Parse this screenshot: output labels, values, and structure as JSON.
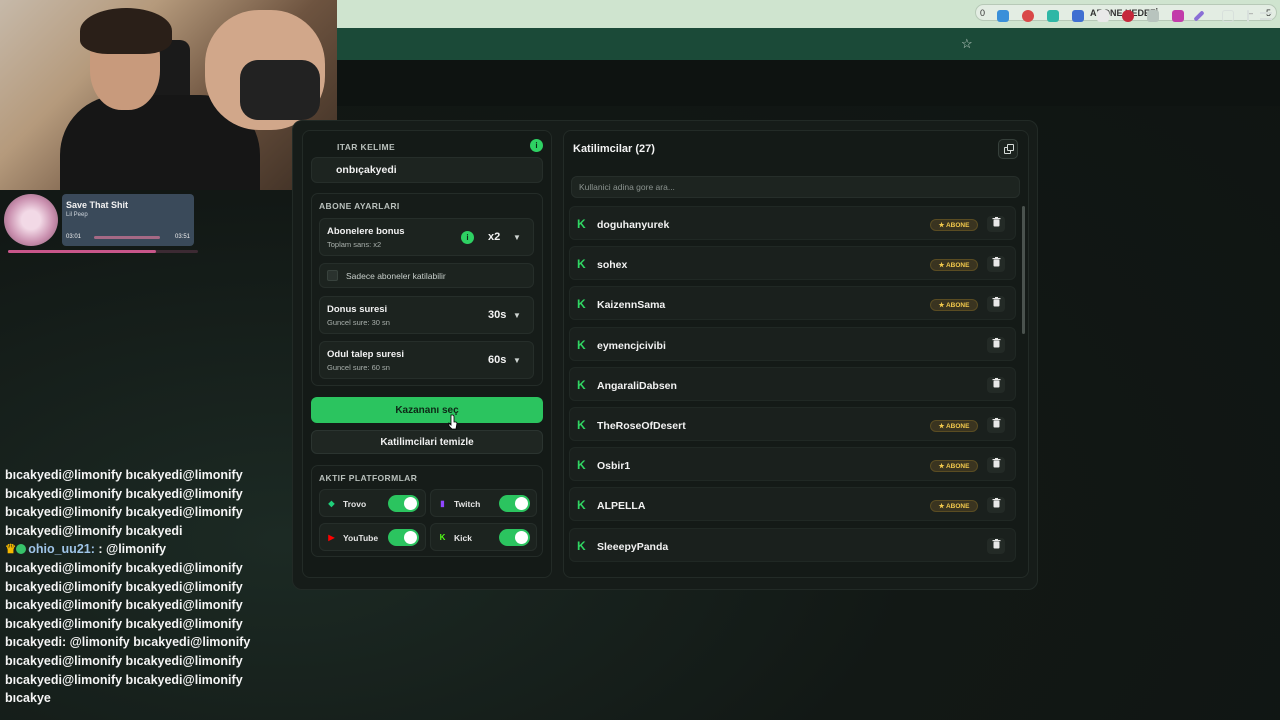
{
  "goal_bar": {
    "left": "0",
    "label": "ABONE HEDEFİ",
    "right": "5"
  },
  "music": {
    "title": "Save That Shit",
    "artist": "Lil Peep",
    "elapsed": "03:01",
    "total": "03:51",
    "progress": 0.78
  },
  "keyword": {
    "label": "ITAR KELIME",
    "value": "onbıçakyedi"
  },
  "subscriber_settings": {
    "label": "ABONE AYARLARI",
    "bonus": {
      "title": "Abonelere bonus",
      "subtitle": "Toplam sans: x2",
      "value": "x2"
    },
    "only_subs": {
      "label": "Sadece aboneler katilabilir",
      "checked": false
    },
    "bonus_time": {
      "title": "Donus suresi",
      "subtitle": "Guncel sure: 30 sn",
      "value": "30s"
    },
    "claim_time": {
      "title": "Odul talep suresi",
      "subtitle": "Guncel sure: 60 sn",
      "value": "60s"
    }
  },
  "buttons": {
    "pick_winner": "Kazananı seç",
    "clear_participants": "Katilimcilari temizle"
  },
  "platforms": {
    "label": "AKTIF PLATFORMLAR",
    "items": [
      {
        "name": "Trovo",
        "enabled": true,
        "color": "#1fd07a"
      },
      {
        "name": "Twitch",
        "enabled": true,
        "color": "#9146ff"
      },
      {
        "name": "YouTube",
        "enabled": true,
        "color": "#ff0000"
      },
      {
        "name": "Kick",
        "enabled": true,
        "color": "#53fc18"
      }
    ]
  },
  "participants": {
    "title": "Katilimcilar (27)",
    "search_placeholder": "Kullanici adina gore ara...",
    "badge_label": "★ ABONE",
    "delete_icon": "trash-icon",
    "list": [
      {
        "name": "doguhanyurek",
        "subscriber": true
      },
      {
        "name": "sohex",
        "subscriber": true
      },
      {
        "name": "KaizennSama",
        "subscriber": true
      },
      {
        "name": "eymencjcivibi",
        "subscriber": false
      },
      {
        "name": "AngaraliDabsen",
        "subscriber": false
      },
      {
        "name": "TheRoseOfDesert",
        "subscriber": true
      },
      {
        "name": "Osbir1",
        "subscriber": true
      },
      {
        "name": "ALPELLA",
        "subscriber": true
      },
      {
        "name": "SleeepyPanda",
        "subscriber": false
      }
    ]
  },
  "chat": {
    "lines_before": [
      "bıcakyedi@limonify bıcakyedi@limonify",
      "bıcakyedi@limonify bıcakyedi@limonify",
      "bıcakyedi@limonify bıcakyedi@limonify",
      "bıcakyedi@limonify bıcakyedi"
    ],
    "user": "ohio_uu21:",
    "user_msg": ": @limonify",
    "lines_after": [
      "bıcakyedi@limonify bıcakyedi@limonify",
      "bıcakyedi@limonify bıcakyedi@limonify",
      "bıcakyedi@limonify bıcakyedi@limonify",
      "bıcakyedi@limonify bıcakyedi@limonify",
      "bıcakyedi: @limonify bıcakyedi@limonify",
      "bıcakyedi@limonify bıcakyedi@limonify",
      "bıcakyedi@limonify bıcakyedi@limonify",
      "bıcakye"
    ]
  }
}
